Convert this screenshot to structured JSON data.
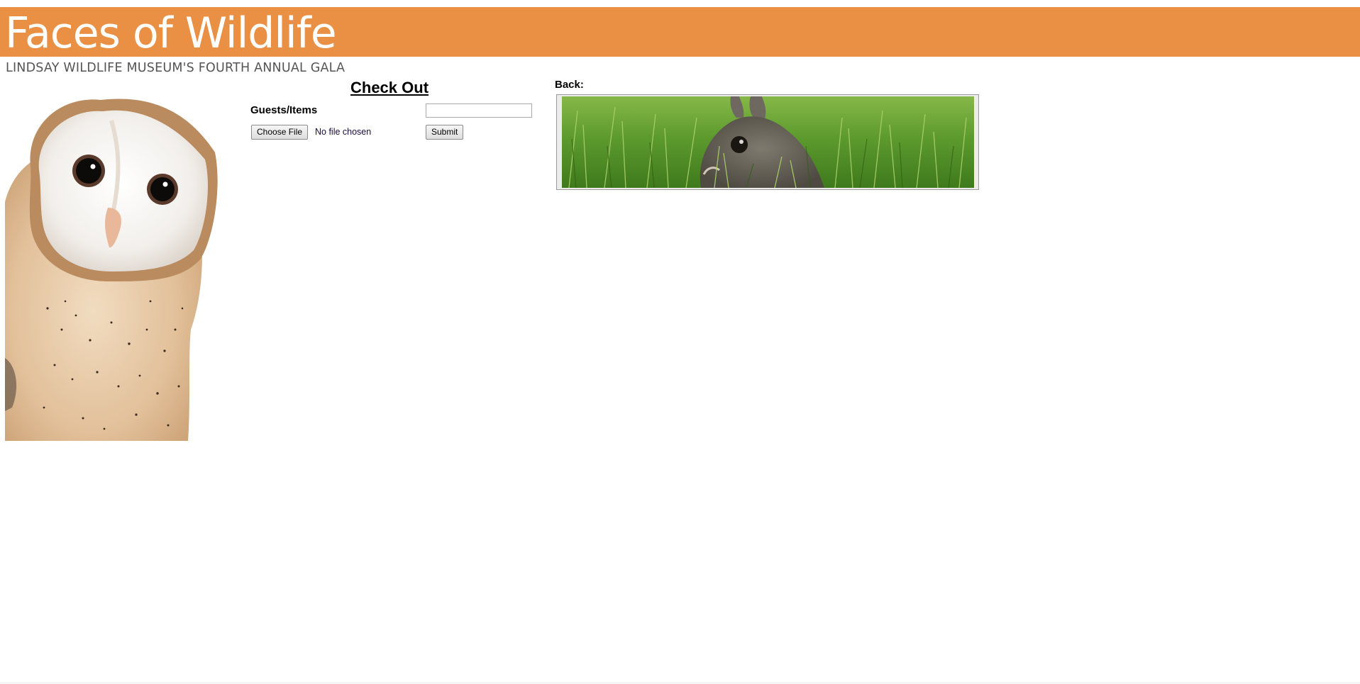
{
  "header": {
    "title": "Faces of Wildlife",
    "subtitle": "LINDSAY WILDLIFE MUSEUM'S FOURTH ANNUAL GALA",
    "bar_color": "#e99045"
  },
  "checkout": {
    "title": "Check Out",
    "guests_label": "Guests/Items",
    "guests_value": "",
    "choose_file_label": "Choose File",
    "file_status": "No file chosen",
    "submit_label": "Submit"
  },
  "back": {
    "label": "Back:"
  },
  "images": {
    "owl": "owl-photo",
    "rabbit": "rabbit-in-grass-photo"
  }
}
